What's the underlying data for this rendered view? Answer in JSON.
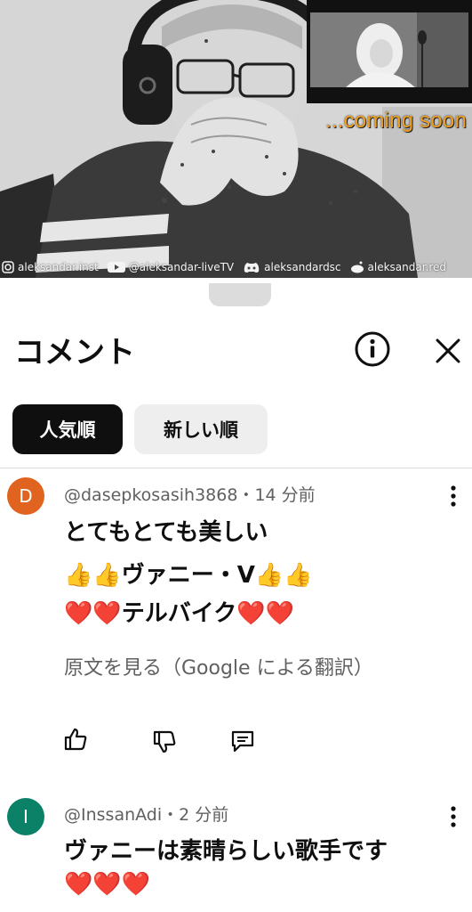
{
  "video": {
    "overlay_text": "...coming soon",
    "watermarks": [
      {
        "icon": "instagram-icon",
        "text": "aleksandar.inst"
      },
      {
        "icon": "youtube-icon",
        "text": "@aleksandar-liveTV"
      },
      {
        "icon": "discord-icon",
        "text": "aleksandardsc"
      },
      {
        "icon": "reddit-icon",
        "text": "aleksandar.red"
      }
    ]
  },
  "sheet": {
    "title": "コメント",
    "info_icon": "info-icon",
    "close_icon": "close-icon"
  },
  "filters": {
    "top": "人気順",
    "newest": "新しい順"
  },
  "comments": [
    {
      "avatar_letter": "D",
      "avatar_color": "#e0631f",
      "author": "@dasepkosasih3868",
      "time": "14 分前",
      "lines": [
        {
          "text": "とてもとても美しい"
        },
        {
          "pre": "👍👍",
          "text": "ヴァニー・V",
          "post": "👍👍"
        },
        {
          "pre": "❤️❤️",
          "text": "テルバイク",
          "post": "❤️❤️"
        }
      ],
      "translate_label": "原文を見る（Google による翻訳）"
    },
    {
      "avatar_letter": "I",
      "avatar_color": "#0b8168",
      "author": "@InssanAdi",
      "time": "2 分前",
      "lines": [
        {
          "text": "ヴァニーは素晴らしい歌手です"
        },
        {
          "pre": "❤️❤️❤️",
          "text": ""
        }
      ]
    }
  ],
  "separator": "・"
}
